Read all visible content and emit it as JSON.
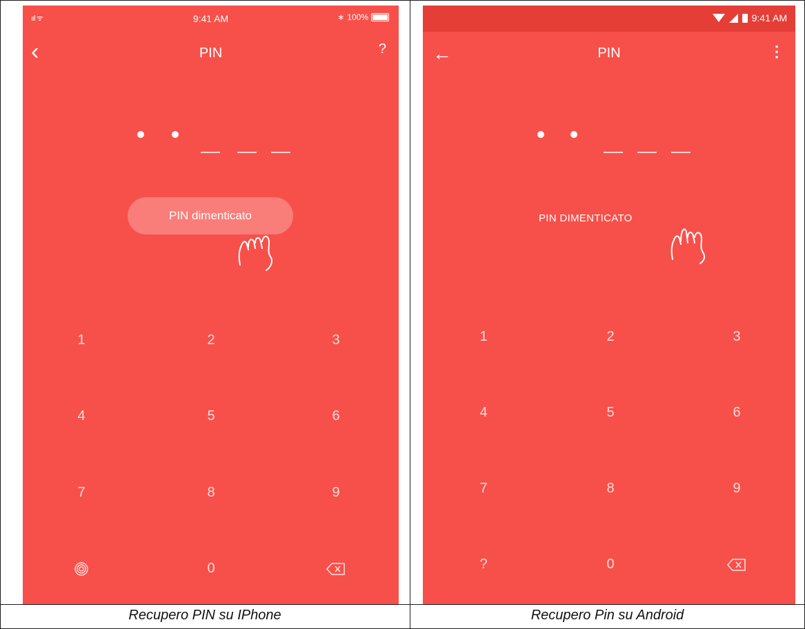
{
  "ios": {
    "status": {
      "signal": "ııl ᯤ",
      "time": "9:41 AM",
      "bluetooth": "∗",
      "battery": "100%"
    },
    "topbar": {
      "back": "‹",
      "title": "PIN",
      "help": "?"
    },
    "forgot_label": "PIN dimenticato",
    "keys": [
      "1",
      "2",
      "3",
      "4",
      "5",
      "6",
      "7",
      "8",
      "9",
      "",
      "0",
      ""
    ],
    "fingerprint_icon": "fingerprint-icon",
    "backspace_icon": "backspace-icon"
  },
  "android": {
    "status": {
      "time": "9:41 AM"
    },
    "topbar": {
      "back": "←",
      "title": "PIN",
      "menu": "⋮"
    },
    "forgot_label": "PIN DIMENTICATO",
    "keys": [
      "1",
      "2",
      "3",
      "4",
      "5",
      "6",
      "7",
      "8",
      "9",
      "?",
      "0",
      ""
    ],
    "backspace_icon": "backspace-icon"
  },
  "pin": {
    "digits_entered": 2,
    "digits_total": 5
  },
  "captions": {
    "left": "Recupero PIN su IPhone",
    "right": "Recupero Pin su Android"
  },
  "colors": {
    "background": "#f7504a",
    "android_status": "#e53e36"
  }
}
